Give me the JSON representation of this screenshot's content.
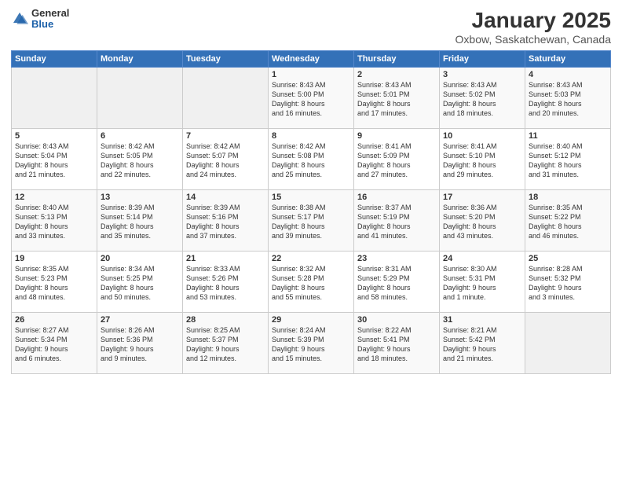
{
  "logo": {
    "general": "General",
    "blue": "Blue"
  },
  "title": "January 2025",
  "subtitle": "Oxbow, Saskatchewan, Canada",
  "days_of_week": [
    "Sunday",
    "Monday",
    "Tuesday",
    "Wednesday",
    "Thursday",
    "Friday",
    "Saturday"
  ],
  "weeks": [
    [
      {
        "day": "",
        "info": ""
      },
      {
        "day": "",
        "info": ""
      },
      {
        "day": "",
        "info": ""
      },
      {
        "day": "1",
        "info": "Sunrise: 8:43 AM\nSunset: 5:00 PM\nDaylight: 8 hours\nand 16 minutes."
      },
      {
        "day": "2",
        "info": "Sunrise: 8:43 AM\nSunset: 5:01 PM\nDaylight: 8 hours\nand 17 minutes."
      },
      {
        "day": "3",
        "info": "Sunrise: 8:43 AM\nSunset: 5:02 PM\nDaylight: 8 hours\nand 18 minutes."
      },
      {
        "day": "4",
        "info": "Sunrise: 8:43 AM\nSunset: 5:03 PM\nDaylight: 8 hours\nand 20 minutes."
      }
    ],
    [
      {
        "day": "5",
        "info": "Sunrise: 8:43 AM\nSunset: 5:04 PM\nDaylight: 8 hours\nand 21 minutes."
      },
      {
        "day": "6",
        "info": "Sunrise: 8:42 AM\nSunset: 5:05 PM\nDaylight: 8 hours\nand 22 minutes."
      },
      {
        "day": "7",
        "info": "Sunrise: 8:42 AM\nSunset: 5:07 PM\nDaylight: 8 hours\nand 24 minutes."
      },
      {
        "day": "8",
        "info": "Sunrise: 8:42 AM\nSunset: 5:08 PM\nDaylight: 8 hours\nand 25 minutes."
      },
      {
        "day": "9",
        "info": "Sunrise: 8:41 AM\nSunset: 5:09 PM\nDaylight: 8 hours\nand 27 minutes."
      },
      {
        "day": "10",
        "info": "Sunrise: 8:41 AM\nSunset: 5:10 PM\nDaylight: 8 hours\nand 29 minutes."
      },
      {
        "day": "11",
        "info": "Sunrise: 8:40 AM\nSunset: 5:12 PM\nDaylight: 8 hours\nand 31 minutes."
      }
    ],
    [
      {
        "day": "12",
        "info": "Sunrise: 8:40 AM\nSunset: 5:13 PM\nDaylight: 8 hours\nand 33 minutes."
      },
      {
        "day": "13",
        "info": "Sunrise: 8:39 AM\nSunset: 5:14 PM\nDaylight: 8 hours\nand 35 minutes."
      },
      {
        "day": "14",
        "info": "Sunrise: 8:39 AM\nSunset: 5:16 PM\nDaylight: 8 hours\nand 37 minutes."
      },
      {
        "day": "15",
        "info": "Sunrise: 8:38 AM\nSunset: 5:17 PM\nDaylight: 8 hours\nand 39 minutes."
      },
      {
        "day": "16",
        "info": "Sunrise: 8:37 AM\nSunset: 5:19 PM\nDaylight: 8 hours\nand 41 minutes."
      },
      {
        "day": "17",
        "info": "Sunrise: 8:36 AM\nSunset: 5:20 PM\nDaylight: 8 hours\nand 43 minutes."
      },
      {
        "day": "18",
        "info": "Sunrise: 8:35 AM\nSunset: 5:22 PM\nDaylight: 8 hours\nand 46 minutes."
      }
    ],
    [
      {
        "day": "19",
        "info": "Sunrise: 8:35 AM\nSunset: 5:23 PM\nDaylight: 8 hours\nand 48 minutes."
      },
      {
        "day": "20",
        "info": "Sunrise: 8:34 AM\nSunset: 5:25 PM\nDaylight: 8 hours\nand 50 minutes."
      },
      {
        "day": "21",
        "info": "Sunrise: 8:33 AM\nSunset: 5:26 PM\nDaylight: 8 hours\nand 53 minutes."
      },
      {
        "day": "22",
        "info": "Sunrise: 8:32 AM\nSunset: 5:28 PM\nDaylight: 8 hours\nand 55 minutes."
      },
      {
        "day": "23",
        "info": "Sunrise: 8:31 AM\nSunset: 5:29 PM\nDaylight: 8 hours\nand 58 minutes."
      },
      {
        "day": "24",
        "info": "Sunrise: 8:30 AM\nSunset: 5:31 PM\nDaylight: 9 hours\nand 1 minute."
      },
      {
        "day": "25",
        "info": "Sunrise: 8:28 AM\nSunset: 5:32 PM\nDaylight: 9 hours\nand 3 minutes."
      }
    ],
    [
      {
        "day": "26",
        "info": "Sunrise: 8:27 AM\nSunset: 5:34 PM\nDaylight: 9 hours\nand 6 minutes."
      },
      {
        "day": "27",
        "info": "Sunrise: 8:26 AM\nSunset: 5:36 PM\nDaylight: 9 hours\nand 9 minutes."
      },
      {
        "day": "28",
        "info": "Sunrise: 8:25 AM\nSunset: 5:37 PM\nDaylight: 9 hours\nand 12 minutes."
      },
      {
        "day": "29",
        "info": "Sunrise: 8:24 AM\nSunset: 5:39 PM\nDaylight: 9 hours\nand 15 minutes."
      },
      {
        "day": "30",
        "info": "Sunrise: 8:22 AM\nSunset: 5:41 PM\nDaylight: 9 hours\nand 18 minutes."
      },
      {
        "day": "31",
        "info": "Sunrise: 8:21 AM\nSunset: 5:42 PM\nDaylight: 9 hours\nand 21 minutes."
      },
      {
        "day": "",
        "info": ""
      }
    ]
  ]
}
